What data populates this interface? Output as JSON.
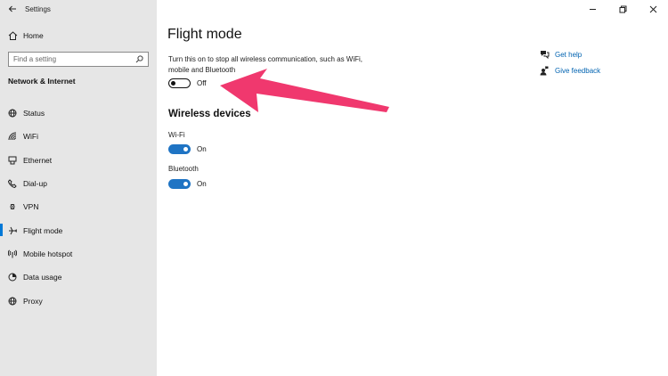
{
  "window": {
    "title": "Settings"
  },
  "sidebar": {
    "home_label": "Home",
    "search_placeholder": "Find a setting",
    "section_title": "Network & Internet",
    "items": [
      {
        "label": "Status",
        "icon": "globe-icon"
      },
      {
        "label": "WiFi",
        "icon": "wifi-icon"
      },
      {
        "label": "Ethernet",
        "icon": "ethernet-icon"
      },
      {
        "label": "Dial-up",
        "icon": "phone-icon"
      },
      {
        "label": "VPN",
        "icon": "vpn-icon"
      },
      {
        "label": "Flight mode",
        "icon": "airplane-icon",
        "active": true
      },
      {
        "label": "Mobile hotspot",
        "icon": "hotspot-icon"
      },
      {
        "label": "Data usage",
        "icon": "data-usage-icon"
      },
      {
        "label": "Proxy",
        "icon": "globe-icon"
      }
    ]
  },
  "main": {
    "title": "Flight mode",
    "description": "Turn this on to stop all wireless communication, such as WiFi, mobile and Bluetooth",
    "flight_toggle_state": "Off",
    "wireless_header": "Wireless devices",
    "wifi_label": "Wi-Fi",
    "wifi_state": "On",
    "bluetooth_label": "Bluetooth",
    "bluetooth_state": "On"
  },
  "help": {
    "get_help": "Get help",
    "give_feedback": "Give feedback"
  },
  "colors": {
    "accent": "#0078d7",
    "toggle_on": "#1f74c4",
    "link": "#0063b1",
    "annotation_arrow": "#f0386e",
    "sidebar_bg": "#e6e6e6"
  }
}
